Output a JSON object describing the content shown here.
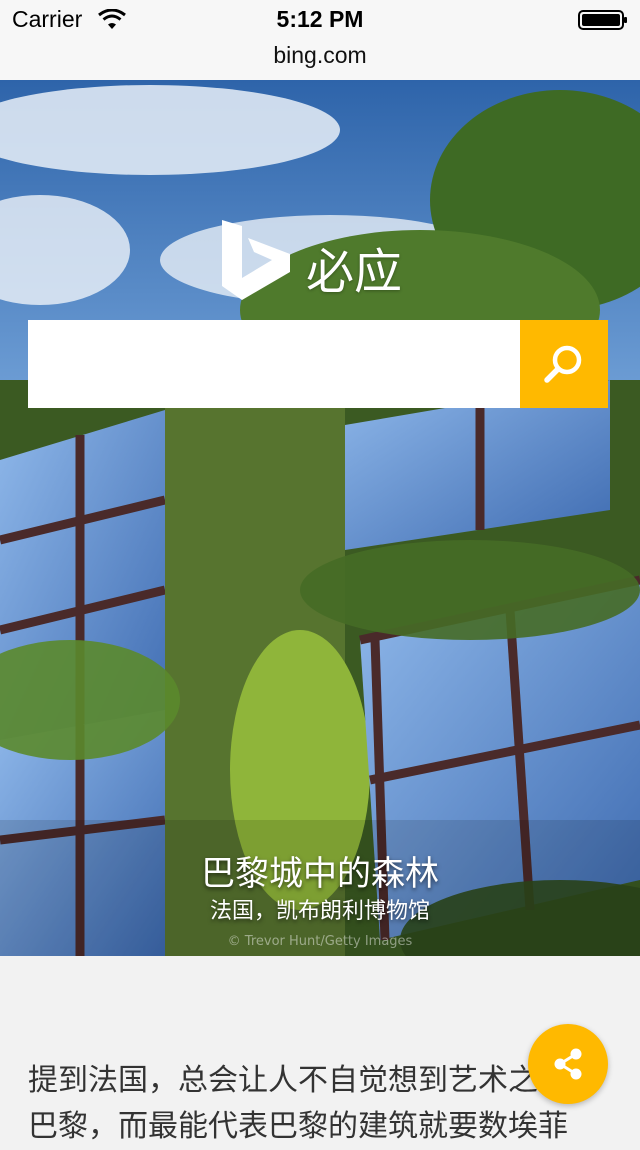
{
  "status_bar": {
    "carrier": "Carrier",
    "time": "5:12 PM",
    "wifi_icon": "wifi-icon",
    "battery_icon": "battery-icon"
  },
  "address_bar": {
    "url": "bing.com"
  },
  "hero": {
    "logo_text": "必应",
    "logo_icon": "bing-logo-icon",
    "search": {
      "value": "",
      "placeholder": ""
    },
    "search_icon": "search-icon",
    "caption_title": "巴黎城中的森林",
    "caption_subtitle": "法国，凯布朗利博物馆",
    "credit": "© Trevor Hunt/Getty Images"
  },
  "article": {
    "text": "提到法国，总会让人不自觉想到艺术之都巴黎，而最能代表巴黎的建筑就要数埃菲"
  },
  "share_icon": "share-icon",
  "colors": {
    "accent": "#ffb900",
    "background": "#f2f2f2"
  }
}
